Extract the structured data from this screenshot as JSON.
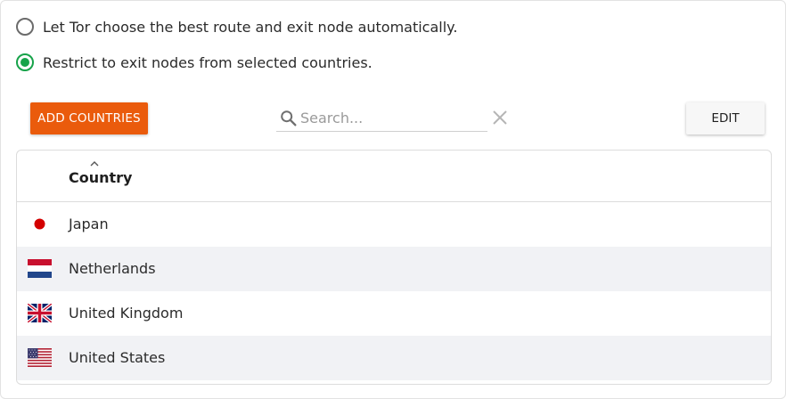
{
  "options": [
    {
      "label": "Let Tor choose the best route and exit node automatically.",
      "checked": false
    },
    {
      "label": "Restrict to exit nodes from selected countries.",
      "checked": true
    }
  ],
  "toolbar": {
    "add_label": "ADD COUNTRIES",
    "search_placeholder": "Search...",
    "search_value": "",
    "edit_label": "EDIT"
  },
  "table": {
    "header": {
      "country": "Country",
      "sort": "ascending"
    },
    "rows": [
      {
        "name": "Japan",
        "flag": "japan-flag-icon"
      },
      {
        "name": "Netherlands",
        "flag": "netherlands-flag-icon"
      },
      {
        "name": "United Kingdom",
        "flag": "united-kingdom-flag-icon"
      },
      {
        "name": "United States",
        "flag": "united-states-flag-icon"
      }
    ]
  },
  "colors": {
    "accent": "#ea5b0c",
    "radio_checked": "#17a34a",
    "row_alt": "#f1f2f5"
  }
}
